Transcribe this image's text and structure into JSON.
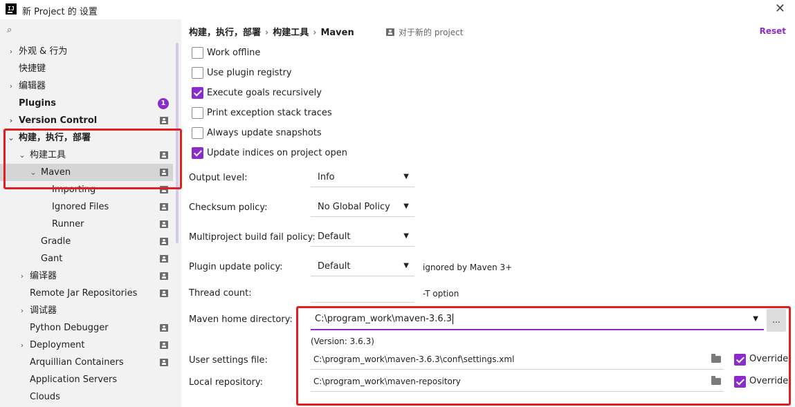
{
  "window": {
    "title": "新 Project 的 设置",
    "close": "✕"
  },
  "sidebar": {
    "search_glyph": "⌕",
    "items": [
      {
        "label": "外观 & 行为",
        "chevron": "›",
        "bold": false,
        "has_proj_icon": false
      },
      {
        "label": "快捷键",
        "chevron": "",
        "bold": false,
        "has_proj_icon": false
      },
      {
        "label": "编辑器",
        "chevron": "›",
        "bold": false,
        "has_proj_icon": false
      },
      {
        "label": "Plugins",
        "chevron": "",
        "bold": true,
        "badge": "1"
      },
      {
        "label": "Version Control",
        "chevron": "›",
        "bold": true,
        "has_proj_icon": true
      },
      {
        "label": "构建，执行，部署",
        "chevron": "⌄",
        "bold": true,
        "has_proj_icon": false
      },
      {
        "label": "构建工具",
        "chevron": "⌄",
        "bold": false,
        "has_proj_icon": true
      },
      {
        "label": "Maven",
        "chevron": "⌄",
        "bold": false,
        "has_proj_icon": true,
        "selected": true
      },
      {
        "label": "Importing",
        "chevron": "",
        "bold": false,
        "has_proj_icon": true
      },
      {
        "label": "Ignored Files",
        "chevron": "",
        "bold": false,
        "has_proj_icon": true
      },
      {
        "label": "Runner",
        "chevron": "",
        "bold": false,
        "has_proj_icon": true
      },
      {
        "label": "Gradle",
        "chevron": "",
        "bold": false,
        "has_proj_icon": true
      },
      {
        "label": "Gant",
        "chevron": "",
        "bold": false,
        "has_proj_icon": true
      },
      {
        "label": "编译器",
        "chevron": "›",
        "bold": false,
        "has_proj_icon": true
      },
      {
        "label": "Remote Jar Repositories",
        "chevron": "",
        "bold": false,
        "has_proj_icon": true
      },
      {
        "label": "调试器",
        "chevron": "›",
        "bold": false,
        "has_proj_icon": false
      },
      {
        "label": "Python Debugger",
        "chevron": "",
        "bold": false,
        "has_proj_icon": true
      },
      {
        "label": "Deployment",
        "chevron": "›",
        "bold": false,
        "has_proj_icon": true
      },
      {
        "label": "Arquillian Containers",
        "chevron": "",
        "bold": false,
        "has_proj_icon": true
      },
      {
        "label": "Application Servers",
        "chevron": "",
        "bold": false,
        "has_proj_icon": false
      },
      {
        "label": "Clouds",
        "chevron": "",
        "bold": false,
        "has_proj_icon": false
      }
    ]
  },
  "breadcrumb": {
    "part1": "构建，执行，部署",
    "part2": "构建工具",
    "part3": "Maven",
    "sep": "›"
  },
  "for_project": "对于新的 project",
  "reset_label": "Reset",
  "checkboxes": {
    "work_offline": {
      "label": "Work offline",
      "checked": false
    },
    "use_plugin_registry": {
      "label": "Use plugin registry",
      "checked": false
    },
    "execute_goals": {
      "label": "Execute goals recursively",
      "checked": true
    },
    "print_exception": {
      "label": "Print exception stack traces",
      "checked": false
    },
    "always_update": {
      "label": "Always update snapshots",
      "checked": false
    },
    "update_indices": {
      "label": "Update indices on project open",
      "checked": true
    }
  },
  "output_level": {
    "label": "Output level:",
    "value": "Info"
  },
  "checksum_policy": {
    "label": "Checksum policy:",
    "value": "No Global Policy"
  },
  "multiproject_policy": {
    "label": "Multiproject build fail policy:",
    "value": "Default"
  },
  "plugin_update_policy": {
    "label": "Plugin update policy:",
    "value": "Default",
    "hint": "ignored by Maven 3+"
  },
  "thread_count": {
    "label": "Thread count:",
    "value": "",
    "hint": "-T option"
  },
  "maven_home": {
    "label": "Maven home directory:",
    "value": "C:\\program_work\\maven-3.6.3",
    "browse": "...",
    "version": "(Version: 3.6.3)"
  },
  "user_settings": {
    "label": "User settings file:",
    "value": "C:\\program_work\\maven-3.6.3\\conf\\settings.xml",
    "override_label": "Override",
    "override_checked": true
  },
  "local_repo": {
    "label": "Local repository:",
    "value": "C:\\program_work\\maven-repository",
    "override_label": "Override",
    "override_checked": true
  },
  "dropdown_arrow": "▼",
  "colors": {
    "accent": "#8c2bcc",
    "highlight_box": "#e02020",
    "sidebar_bg": "#f2f2f2",
    "selected_row": "#d5d5d5"
  }
}
